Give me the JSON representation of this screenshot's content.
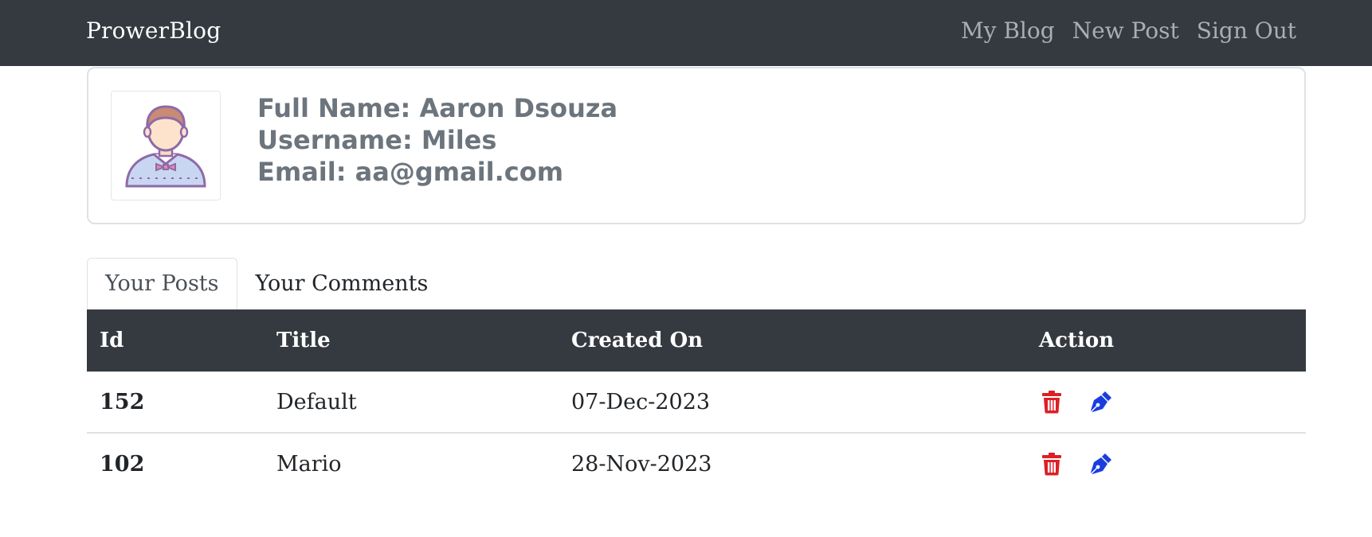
{
  "navbar": {
    "brand": "ProwerBlog",
    "links": [
      {
        "label": "My Blog"
      },
      {
        "label": "New Post"
      },
      {
        "label": "Sign Out"
      }
    ]
  },
  "profile": {
    "avatar_icon": "user-avatar-icon",
    "full_name_line": "Full Name: Aaron Dsouza",
    "username_line": "Username: Miles",
    "email_line": "Email: aa@gmail.com"
  },
  "tabs": [
    {
      "label": "Your Posts",
      "active": true
    },
    {
      "label": "Your Comments",
      "active": false
    }
  ],
  "posts_table": {
    "headers": [
      "Id",
      "Title",
      "Created On",
      "Action"
    ],
    "rows": [
      {
        "id": "152",
        "title": "Default",
        "created_on": "07-Dec-2023"
      },
      {
        "id": "102",
        "title": "Mario",
        "created_on": "28-Nov-2023"
      }
    ],
    "action_icons": {
      "delete": "trash-icon",
      "edit": "pen-icon"
    }
  },
  "colors": {
    "navbar_bg": "#343a40",
    "delete": "#dc1f26",
    "edit": "#1a3de0",
    "profile_text": "#6c757d"
  }
}
